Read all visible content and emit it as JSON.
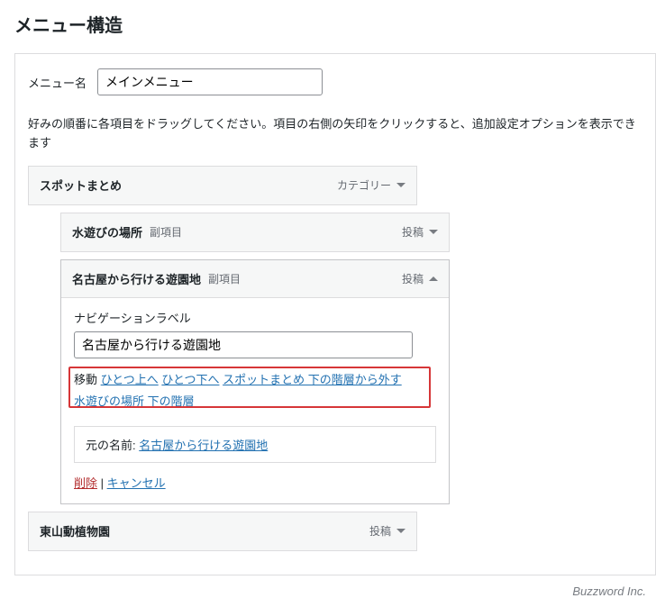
{
  "page_title": "メニュー構造",
  "menu_name_label": "メニュー名",
  "menu_name_value": "メインメニュー",
  "instruction": "好みの順番に各項目をドラッグしてください。項目の右側の矢印をクリックすると、追加設定オプションを表示できます",
  "items": {
    "a": {
      "title": "スポットまとめ",
      "type": "カテゴリー"
    },
    "b": {
      "title": "水遊びの場所",
      "sub": "副項目",
      "type": "投稿"
    },
    "c": {
      "title": "名古屋から行ける遊園地",
      "sub": "副項目",
      "type": "投稿"
    },
    "d": {
      "title": "東山動植物園",
      "type": "投稿"
    }
  },
  "edit": {
    "nav_label_text": "ナビゲーションラベル",
    "nav_label_value": "名古屋から行ける遊園地",
    "move_label": "移動",
    "move_up": "ひとつ上へ",
    "move_down": "ひとつ下へ",
    "move_out_parent": "スポットまとめ 下の階層から外す",
    "move_under_sibling": "水遊びの場所 下の階層",
    "original_label": "元の名前:",
    "original_link": "名古屋から行ける遊園地",
    "remove": "削除",
    "cancel": "キャンセル",
    "sep": " | "
  },
  "brand": "Buzzword Inc."
}
